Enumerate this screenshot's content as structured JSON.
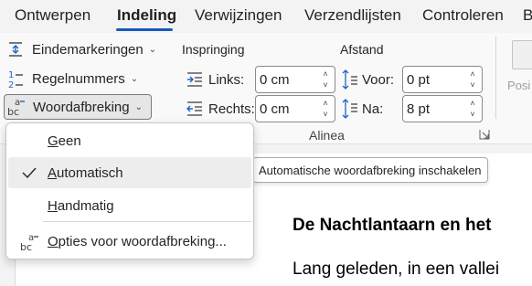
{
  "tabs": [
    {
      "label": "Ontwerpen",
      "active": false
    },
    {
      "label": "Indeling",
      "active": true
    },
    {
      "label": "Verwijzingen",
      "active": false
    },
    {
      "label": "Verzendlijsten",
      "active": false
    },
    {
      "label": "Controleren",
      "active": false
    },
    {
      "label": "B",
      "active": false
    }
  ],
  "page_setup": {
    "eindemarkeringen": "Eindemarkeringen",
    "regelnummers": "Regelnummers",
    "woordafbreking": "Woordafbreking"
  },
  "paragraph": {
    "inspringing_label": "Inspringing",
    "afstand_label": "Afstand",
    "links_label": "Links:",
    "links_value": "0 cm",
    "rechts_label": "Rechts:",
    "rechts_value": "0 cm",
    "voor_label": "Voor:",
    "voor_value": "0 pt",
    "na_label": "Na:",
    "na_value": "8 pt",
    "group_label": "Alinea"
  },
  "arrange": {
    "position_label": "Posi"
  },
  "hyphenation_menu": {
    "items": [
      {
        "label": "Geen",
        "checked": false
      },
      {
        "label": "Automatisch",
        "checked": true
      },
      {
        "label": "Handmatig",
        "checked": false
      },
      {
        "label": "Opties voor woordafbreking...",
        "checked": false
      }
    ]
  },
  "tooltip": "Automatische woordafbreking inschakelen",
  "document": {
    "heading": "De Nachtlantaarn en het",
    "body": "Lang geleden, in een vallei"
  },
  "colors": {
    "accent": "#185abd",
    "icon_blue": "#1e64c8"
  }
}
